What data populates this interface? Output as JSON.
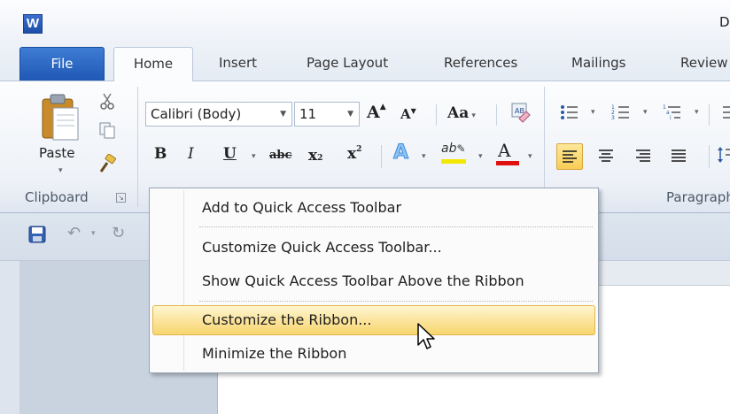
{
  "window": {
    "app_icon_letter": "W",
    "title_fragment": "D"
  },
  "tabs": [
    {
      "label": "File"
    },
    {
      "label": "Home"
    },
    {
      "label": "Insert"
    },
    {
      "label": "Page Layout"
    },
    {
      "label": "References"
    },
    {
      "label": "Mailings"
    },
    {
      "label": "Review"
    }
  ],
  "ribbon": {
    "clipboard": {
      "paste_label": "Paste",
      "group_label": "Clipboard"
    },
    "font": {
      "font_name": "Calibri (Body)",
      "font_size": "11"
    },
    "paragraph": {
      "group_label": "Paragraph"
    }
  },
  "context_menu": {
    "items": [
      {
        "label": "Add to Quick Access Toolbar"
      },
      {
        "label": "Customize Quick Access Toolbar..."
      },
      {
        "label": "Show Quick Access Toolbar Above the Ribbon"
      },
      {
        "label": "Customize the Ribbon..."
      },
      {
        "label": "Minimize the Ribbon"
      }
    ]
  },
  "colors": {
    "file_tab": "#2a66c2",
    "highlight": "#fbe39a",
    "font_color_underline": "#e01010",
    "highlighter_underline": "#f5e800"
  }
}
